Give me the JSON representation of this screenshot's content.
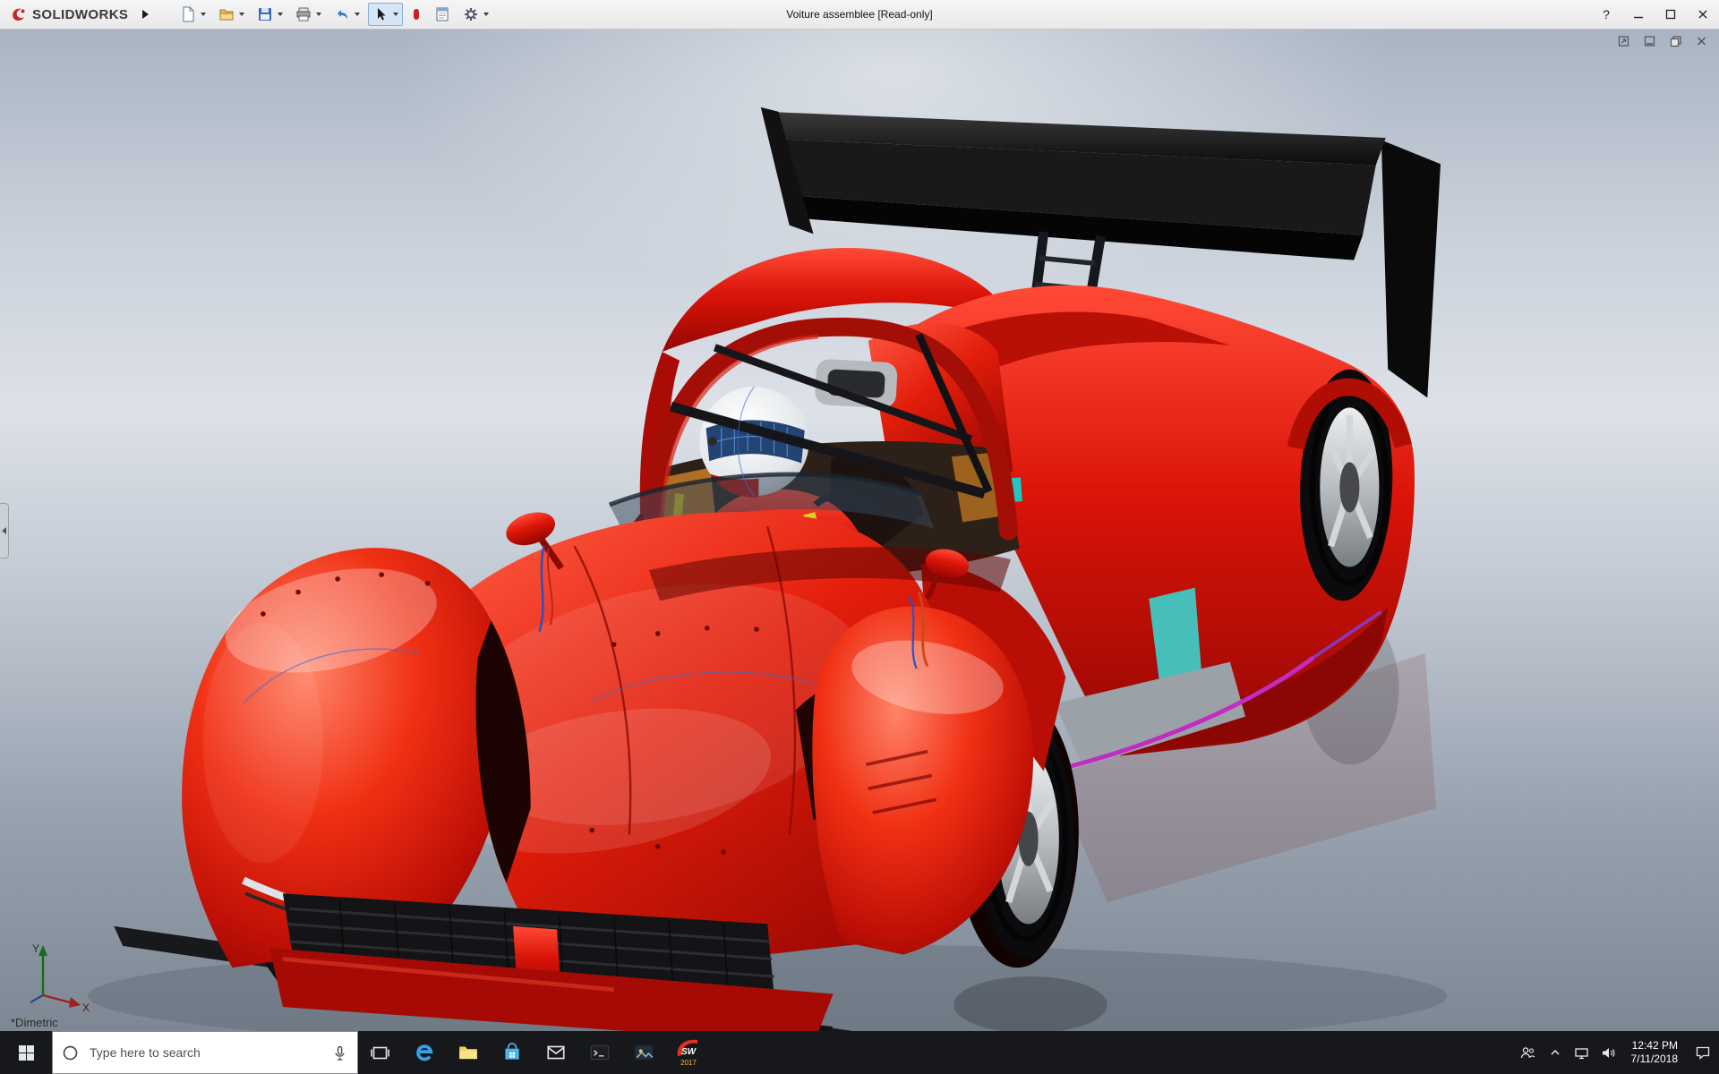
{
  "app": {
    "brand": "SOLIDWORKS",
    "title": "Voiture assemblee [Read-only]",
    "help_label": "?"
  },
  "titlebar": {
    "tools": [
      "new-document",
      "open",
      "save",
      "print",
      "undo",
      "select-cursor",
      "instant3d",
      "evaluate-sheet",
      "options"
    ],
    "window_controls": [
      "minimize",
      "maximize",
      "close"
    ]
  },
  "document_window": {
    "controls": [
      "pop-out",
      "minimize",
      "restore",
      "close"
    ]
  },
  "viewport": {
    "orientation_label": "*Dimetric",
    "triad": {
      "x": "X",
      "y": "Y"
    }
  },
  "model": {
    "body_color": "#d81508",
    "wing_color": "#121212",
    "rim_color": "#c4c8cc",
    "accent_cyan": "#40c8c4",
    "accent_magenta": "#c22cc2",
    "harness_yellow": "#e0d020",
    "helmet_color": "#ffffff",
    "visor_color": "#16386a"
  },
  "taskbar": {
    "search_placeholder": "Type here to search",
    "app_icons": [
      "start",
      "task-view",
      "edge",
      "file-explorer",
      "store",
      "mail",
      "terminal",
      "photos",
      "solidworks-2017"
    ],
    "solidworks_logo_text": "SW",
    "solidworks_version": "2017",
    "tray_icons": [
      "people",
      "hidden-icons-chevron",
      "network",
      "volume",
      "action-center"
    ],
    "clock": {
      "time": "12:42 PM",
      "date": "7/11/2018"
    }
  }
}
